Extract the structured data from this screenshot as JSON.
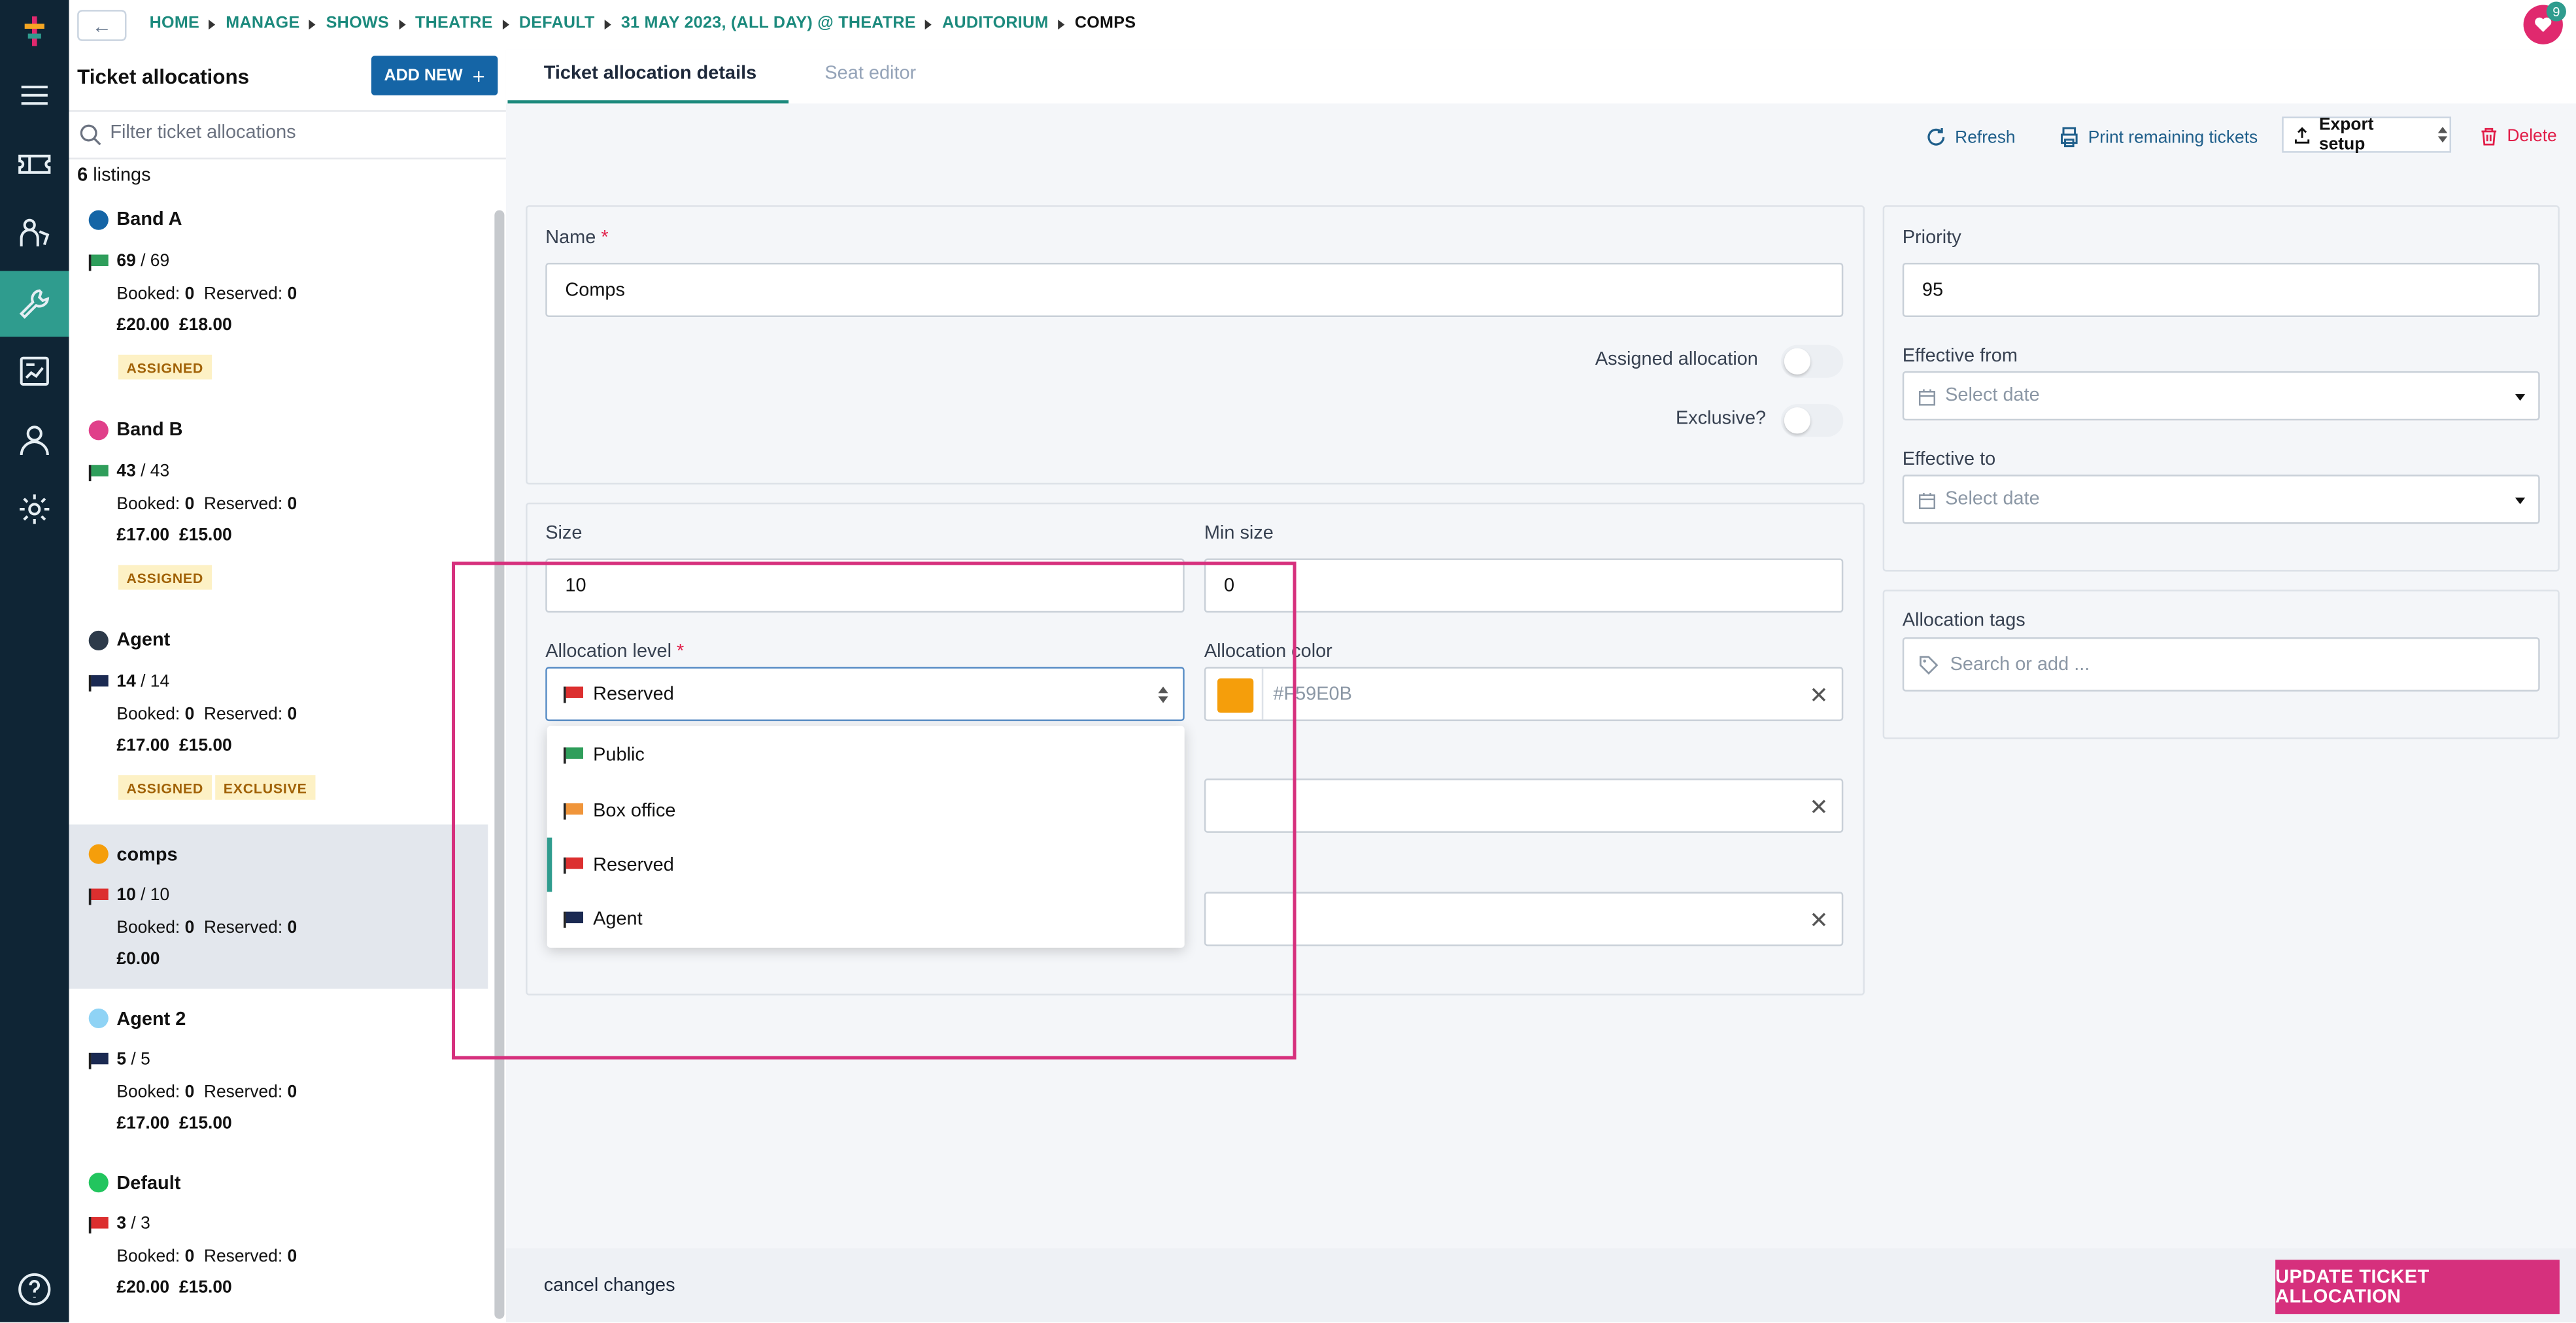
{
  "breadcrumb": {
    "back_symbol": "←",
    "items": [
      "HOME",
      "MANAGE",
      "SHOWS",
      "THEATRE",
      "DEFAULT",
      "31 MAY 2023, (ALL DAY) @ THEATRE",
      "AUDITORIUM",
      "COMPS"
    ]
  },
  "notifications": {
    "count": "9"
  },
  "allocations": {
    "title": "Ticket allocations",
    "add_new_label": "ADD NEW",
    "add_symbol": "+",
    "filter_placeholder": "Filter ticket allocations",
    "listings_count": "6",
    "listings_label": "listings",
    "items": [
      {
        "name": "Band A",
        "dot_color": "#1565a6",
        "flag_color": "#2f9e5b",
        "count": "69",
        "total": "/ 69",
        "booked_label": "Booked:",
        "booked": "0",
        "reserved_label": "Reserved:",
        "reserved": "0",
        "prices": "£20.00 £18.00",
        "tags": [
          "ASSIGNED"
        ]
      },
      {
        "name": "Band B",
        "dot_color": "#e0408a",
        "flag_color": "#2f9e5b",
        "count": "43",
        "total": "/ 43",
        "booked_label": "Booked:",
        "booked": "0",
        "reserved_label": "Reserved:",
        "reserved": "0",
        "prices": "£17.00 £15.00",
        "tags": [
          "ASSIGNED"
        ]
      },
      {
        "name": "Agent",
        "dot_color": "#2d3a4a",
        "flag_color": "#1b2a52",
        "count": "14",
        "total": "/ 14",
        "booked_label": "Booked:",
        "booked": "0",
        "reserved_label": "Reserved:",
        "reserved": "0",
        "prices": "£17.00 £15.00",
        "tags": [
          "ASSIGNED",
          "EXCLUSIVE"
        ]
      },
      {
        "name": "comps",
        "dot_color": "#f59e0b",
        "flag_color": "#dc2f2f",
        "count": "10",
        "total": "/ 10",
        "booked_label": "Booked:",
        "booked": "0",
        "reserved_label": "Reserved:",
        "reserved": "0",
        "prices": "£0.00",
        "tags": []
      },
      {
        "name": "Agent 2",
        "dot_color": "#8fd3f5",
        "flag_color": "#1b2a52",
        "count": "5",
        "total": "/ 5",
        "booked_label": "Booked:",
        "booked": "0",
        "reserved_label": "Reserved:",
        "reserved": "0",
        "prices": "£17.00 £15.00",
        "tags": []
      },
      {
        "name": "Default",
        "dot_color": "#22c55e",
        "flag_color": "#dc2f2f",
        "count": "3",
        "total": "/ 3",
        "booked_label": "Booked:",
        "booked": "0",
        "reserved_label": "Reserved:",
        "reserved": "0",
        "prices": "£20.00 £15.00",
        "tags": []
      }
    ]
  },
  "tabs": {
    "details": "Ticket allocation details",
    "seat_editor": "Seat editor"
  },
  "toolbar": {
    "refresh": "Refresh",
    "print": "Print remaining tickets",
    "export": "Export setup",
    "delete": "Delete"
  },
  "form": {
    "name_label": "Name",
    "required_mark": "*",
    "name_value": "Comps",
    "assigned_label": "Assigned allocation",
    "exclusive_label": "Exclusive?",
    "size_label": "Size",
    "size_value": "10",
    "min_size_label": "Min size",
    "min_size_value": "0",
    "level_label": "Allocation level",
    "level_value": "Reserved",
    "color_label": "Allocation color",
    "color_value": "#F59E0B",
    "priority_label": "Priority",
    "priority_value": "95",
    "effective_from_label": "Effective from",
    "effective_to_label": "Effective to",
    "date_placeholder": "Select date",
    "tags_label": "Allocation tags",
    "tags_placeholder": "Search or add ..."
  },
  "level_options": [
    {
      "label": "Public",
      "flag_color": "#2f9e5b"
    },
    {
      "label": "Box office",
      "flag_color": "#f0953a"
    },
    {
      "label": "Reserved",
      "flag_color": "#dc2f2f",
      "selected": true
    },
    {
      "label": "Agent",
      "flag_color": "#1b2a52"
    }
  ],
  "footer": {
    "cancel": "cancel changes",
    "update": "UPDATE TICKET ALLOCATION"
  }
}
